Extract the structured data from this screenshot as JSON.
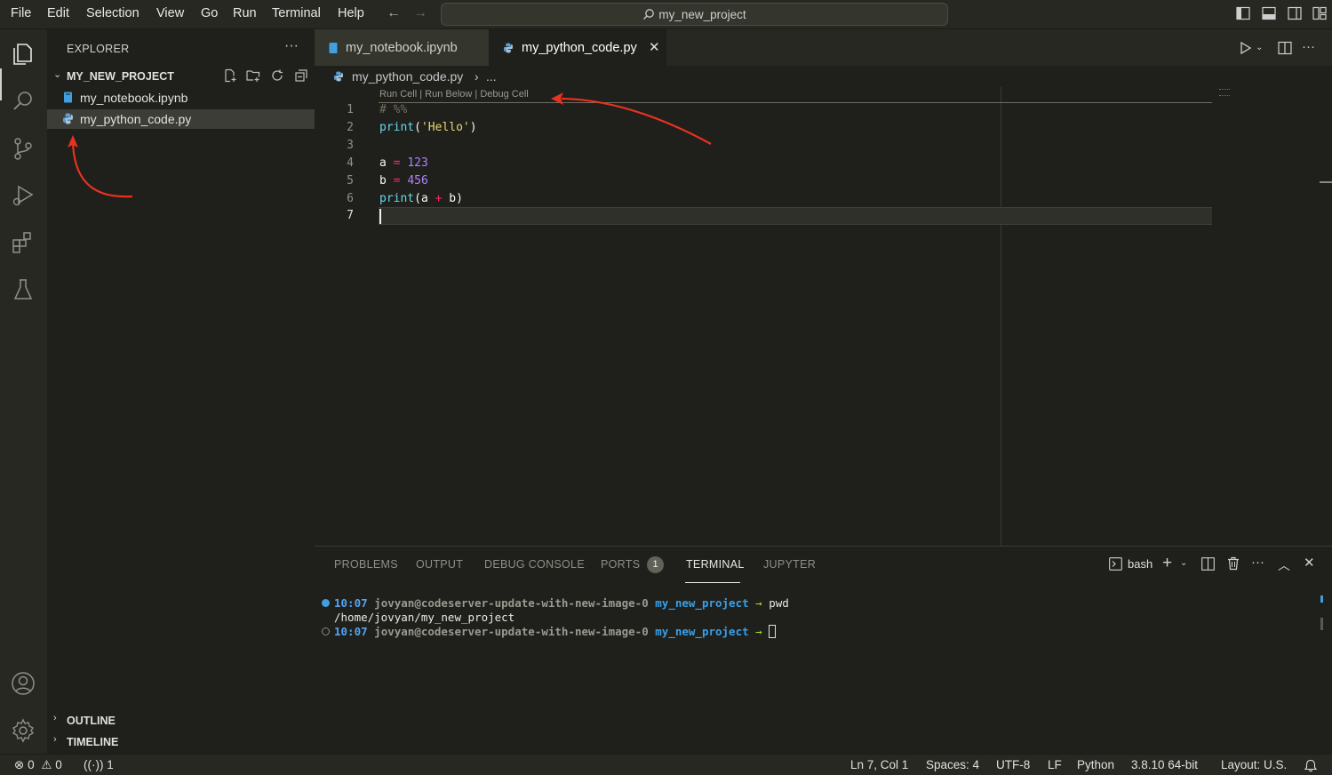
{
  "menu": [
    "File",
    "Edit",
    "Selection",
    "View",
    "Go",
    "Run",
    "Terminal",
    "Help"
  ],
  "command_center": {
    "label": "my_new_project",
    "icon": "search-icon"
  },
  "sidebar": {
    "title": "EXPLORER",
    "more": "···",
    "project": "MY_NEW_PROJECT",
    "files": [
      {
        "name": "my_notebook.ipynb",
        "icon": "notebook-file-icon",
        "selected": false
      },
      {
        "name": "my_python_code.py",
        "icon": "python-file-icon",
        "selected": true
      }
    ],
    "bottom_sections": [
      "OUTLINE",
      "TIMELINE"
    ]
  },
  "tabs": [
    {
      "label": "my_notebook.ipynb",
      "active": false
    },
    {
      "label": "my_python_code.py",
      "active": true,
      "close": "✕"
    }
  ],
  "breadcrumb": {
    "file": "my_python_code.py",
    "sep": "›",
    "rest": "..."
  },
  "editor": {
    "codelens": "Run Cell | Run Below | Debug Cell",
    "line_numbers": [
      "1",
      "2",
      "3",
      "4",
      "5",
      "6",
      "7"
    ],
    "lines": {
      "l1": "# %%",
      "l2_fn": "print",
      "l2_open": "(",
      "l2_str": "'Hello'",
      "l2_close": ")",
      "l4_var": "a",
      "l4_op": "=",
      "l4_num": "123",
      "l5_var": "b",
      "l5_op": "=",
      "l5_num": "456",
      "l6_fn": "print",
      "l6_open": "(a",
      "l6_op": "+",
      "l6_close": "b)"
    },
    "current_line": 7
  },
  "panel": {
    "tabs": [
      "PROBLEMS",
      "OUTPUT",
      "DEBUG CONSOLE",
      "PORTS",
      "TERMINAL",
      "JUPYTER"
    ],
    "active_tab": "TERMINAL",
    "ports_badge": "1",
    "shell": "bash",
    "terminal": [
      {
        "time": "10:07",
        "user": "jovyan@codeserver-update-with-new-image-0",
        "dir": "my_new_project",
        "arrow": "→",
        "cmd": "pwd"
      },
      {
        "output": "/home/jovyan/my_new_project"
      },
      {
        "time": "10:07",
        "user": "jovyan@codeserver-update-with-new-image-0",
        "dir": "my_new_project",
        "arrow": "→",
        "cmd": ""
      }
    ]
  },
  "statusbar": {
    "errors": "0",
    "warnings": "0",
    "ports": "1",
    "position": "Ln 7, Col 1",
    "spaces": "Spaces: 4",
    "encoding": "UTF-8",
    "eol": "LF",
    "language": "Python",
    "interpreter": "3.8.10 64-bit",
    "layout": "Layout: U.S."
  },
  "colors": {
    "annotation_arrow": "#e8321f",
    "background": "#1f1f1b",
    "chrome": "#272822"
  }
}
